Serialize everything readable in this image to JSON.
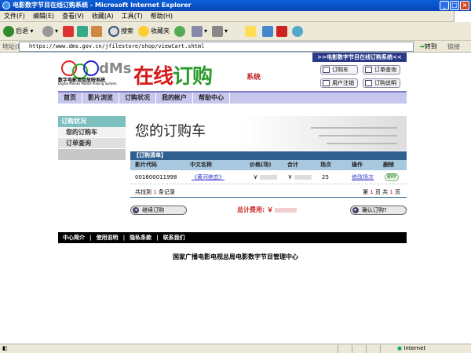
{
  "window": {
    "title": "电影数字节目在线订购系统 - Microsoft Internet Explorer"
  },
  "menu": [
    "文件(F)",
    "编辑(E)",
    "查看(V)",
    "收藏(A)",
    "工具(T)",
    "帮助(H)"
  ],
  "toolbar": {
    "back": "后退",
    "search": "搜索",
    "favorites": "收藏夹"
  },
  "address": {
    "label": "地址(D)",
    "url": "https://www.dms.gov.cn/jfilestore/shop/viewCart.shtml",
    "go": "转到",
    "links": "链接"
  },
  "site": {
    "title_part1": "在线",
    "title_part2": "订购",
    "title_sys": "系统",
    "banner": ">>电影数字节目在线订购系统<<",
    "logo_cn": "数字电影流动放映系统",
    "logo_en": "Digital Movies Mobile Playing System",
    "top_buttons": [
      "订购车",
      "订单查询",
      "用户注销",
      "订购说明"
    ],
    "nav": [
      "首页",
      "影片浏览",
      "订购状况",
      "我的帐户",
      "帮助中心"
    ]
  },
  "sidebar": {
    "title": "订购状况",
    "items": [
      "您的订购车",
      "订单查询"
    ]
  },
  "cart": {
    "title": "您的订购车",
    "list_title": "【订购清单】",
    "columns": [
      "影片代码",
      "中文名称",
      "价格(场)",
      "合计",
      "场次",
      "操作",
      "删除"
    ],
    "rows": [
      {
        "code": "001600011998",
        "name": "《黄河绝恋》",
        "price_prefix": "￥",
        "total_prefix": "￥",
        "sessions": "25",
        "action": "修改场次",
        "delete": "删除"
      }
    ],
    "summary_prefix": "共找到",
    "summary_count": "1",
    "summary_suffix": "条记录",
    "page_label": "第",
    "page_current": "1",
    "page_mid": "页 共",
    "page_total": "1",
    "page_end": "页",
    "continue_btn": "继续订购",
    "total_label": "总计费用: ￥",
    "confirm_btn": "确认订购?"
  },
  "footer": {
    "links": [
      "中心简介",
      "使用说明",
      "隐私条款",
      "联系我们"
    ],
    "org": "国家广播电影电视总局电影数字节目管理中心"
  },
  "status": {
    "zone": "Internet"
  }
}
